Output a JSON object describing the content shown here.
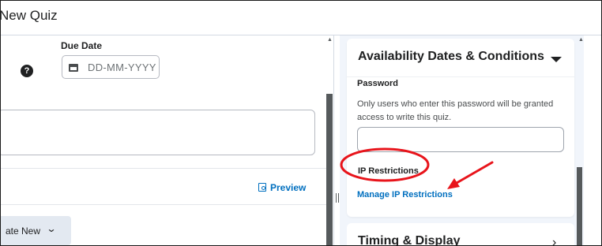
{
  "header": {
    "title": "New Quiz"
  },
  "left_pane": {
    "due_date": {
      "label": "Due Date",
      "placeholder": "DD-MM-YYYY"
    },
    "preview_label": "Preview",
    "create_new_label": "ate New"
  },
  "right_pane": {
    "availability": {
      "title": "Availability Dates & Conditions",
      "password_label": "Password",
      "password_help": "Only users who enter this password will be granted access to write this quiz.",
      "ip_label": "IP Restrictions",
      "ip_link": "Manage IP Restrictions"
    },
    "next_section_title": "Timing & Display"
  },
  "colors": {
    "link": "#006fbf",
    "annotation": "#e8141b",
    "panel_bg": "#f1f5fb"
  },
  "icons": [
    "help-icon",
    "calendar-icon",
    "preview-icon",
    "chevron-down-icon",
    "chevron-right-icon"
  ]
}
